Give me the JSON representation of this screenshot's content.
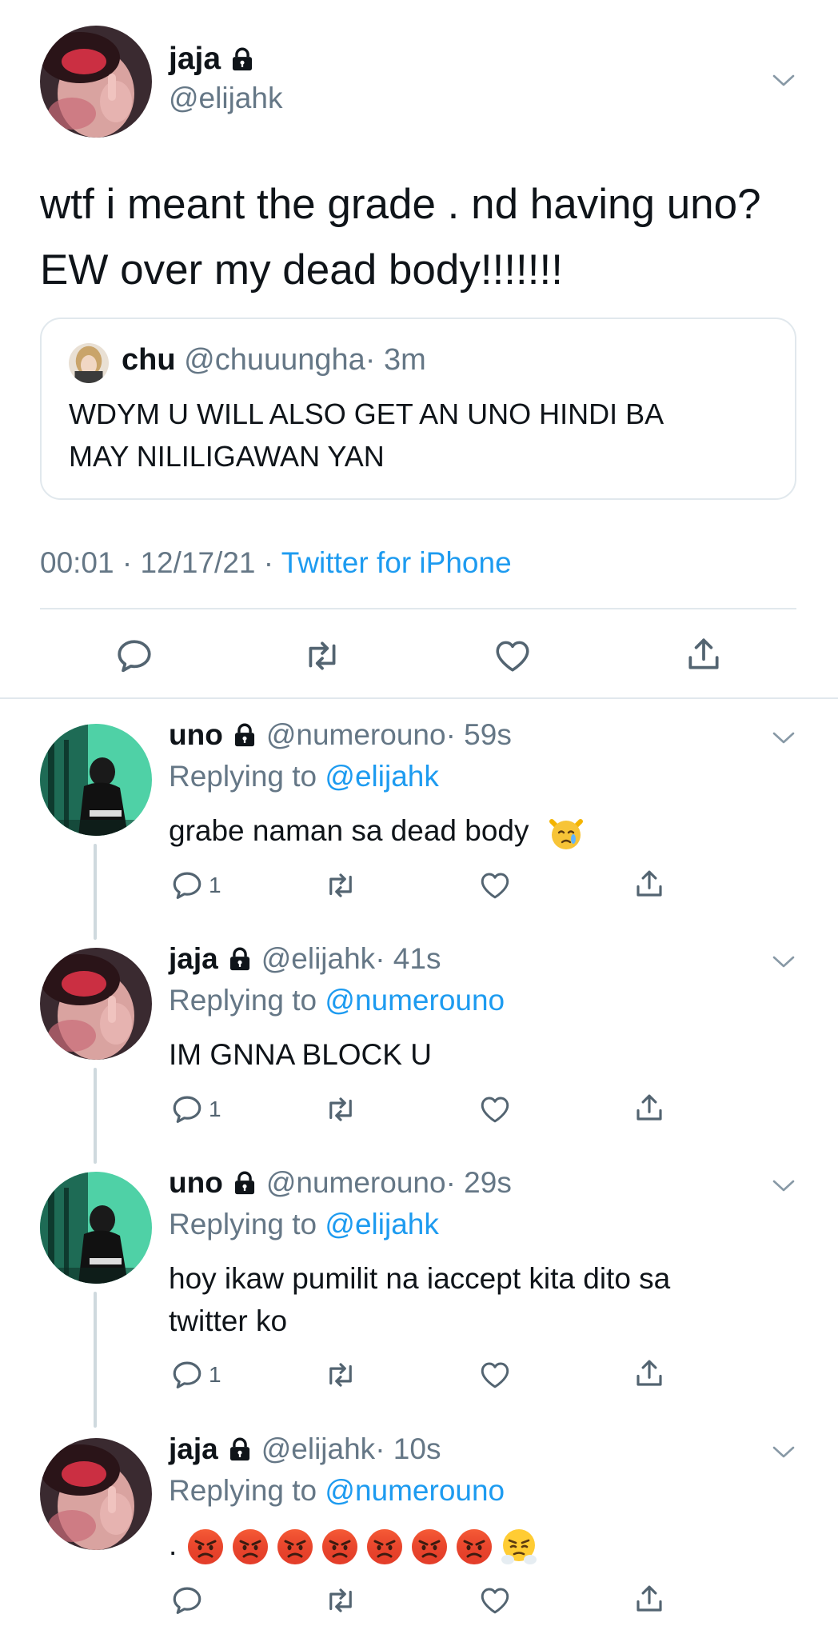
{
  "colors": {
    "link": "#1d9bf0",
    "muted": "#657786",
    "divider": "#e1e8ed"
  },
  "main_tweet": {
    "name": "jaja",
    "handle": "@elijahk",
    "text_line1": "wtf i meant the grade . nd having uno?",
    "text_line2": "EW over my dead body!!!!!!!",
    "quoted": {
      "name": "chu",
      "handle": "@chuuungha",
      "time": "· 3m",
      "text_line1": "WDYM U WILL ALSO GET AN UNO HINDI BA",
      "text_line2": "MAY NILILIGAWAN YAN"
    },
    "timestamp": "00:01 · 12/17/21 ·",
    "client": "Twitter for iPhone"
  },
  "replies": [
    {
      "name": "uno",
      "handle": "@numerouno",
      "time": "· 59s",
      "replying_prefix": "Replying to",
      "replying_to": "@elijahk",
      "text": "grabe naman sa dead body",
      "reply_count": "1"
    },
    {
      "name": "jaja",
      "handle": "@elijahk",
      "time": "· 41s",
      "replying_prefix": "Replying to",
      "replying_to": "@numerouno",
      "text": "IM GNNA BLOCK U",
      "reply_count": "1"
    },
    {
      "name": "uno",
      "handle": "@numerouno",
      "time": "· 29s",
      "replying_prefix": "Replying to",
      "replying_to": "@elijahk",
      "text_line1": "hoy ikaw pumilit na iaccept kita dito sa",
      "text_line2": "twitter ko",
      "reply_count": "1"
    },
    {
      "name": "jaja",
      "handle": "@elijahk",
      "time": "· 10s",
      "replying_prefix": "Replying to",
      "replying_to": "@numerouno",
      "text": "."
    }
  ],
  "icons": [
    "lock-icon",
    "chevron-down-icon",
    "reply-icon",
    "retweet-icon",
    "like-icon",
    "share-icon",
    "crying-cat-emoji",
    "angry-face-emoji",
    "steam-nose-emoji"
  ]
}
